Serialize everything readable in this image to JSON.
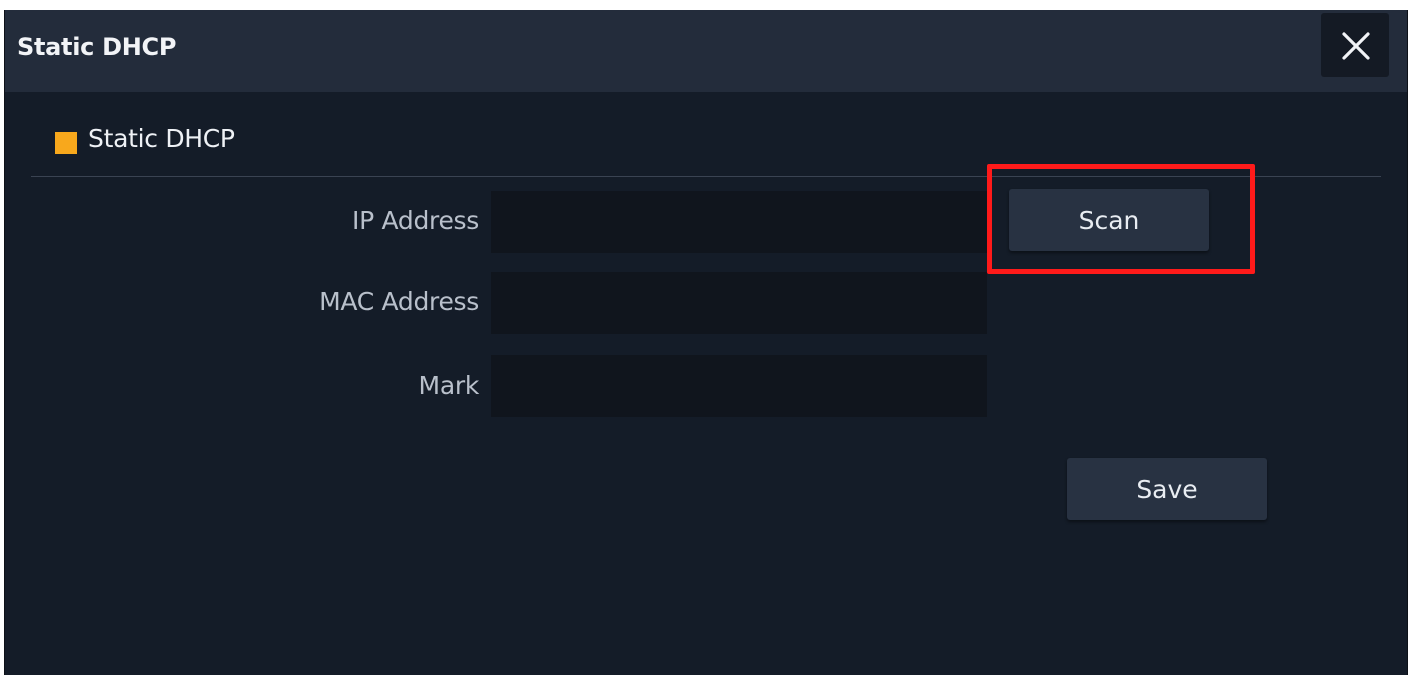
{
  "dialog": {
    "title": "Static DHCP",
    "close_icon": "close-icon"
  },
  "section": {
    "title": "Static DHCP",
    "marker_color": "#f8a81c"
  },
  "form": {
    "ip_address": {
      "label": "IP Address",
      "value": ""
    },
    "mac_address": {
      "label": "MAC Address",
      "value": ""
    },
    "mark": {
      "label": "Mark",
      "value": ""
    }
  },
  "buttons": {
    "scan_label": "Scan",
    "save_label": "Save"
  },
  "highlight": {
    "target": "scan-button",
    "color": "#ff1a1a"
  }
}
